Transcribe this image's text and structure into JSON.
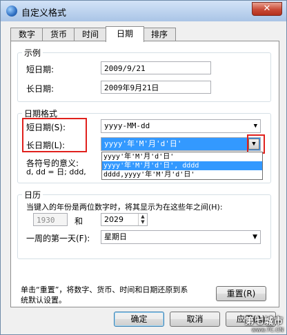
{
  "window": {
    "title": "自定义格式",
    "close_glyph": "✕"
  },
  "tabs": [
    {
      "label": "数字"
    },
    {
      "label": "货币"
    },
    {
      "label": "时间"
    },
    {
      "label": "日期"
    },
    {
      "label": "排序"
    }
  ],
  "example": {
    "group_title": "示例",
    "short_label": "短日期:",
    "short_value": "2009/9/21",
    "long_label": "长日期:",
    "long_value": "2009年9月21日"
  },
  "date_format": {
    "group_title": "日期格式",
    "short_label": "短日期(S):",
    "short_value": "yyyy-MM-dd",
    "long_label": "长日期(L):",
    "long_value": "yyyy'年'M'月'd'日'",
    "symbols_label": "各符号的意义:",
    "symbols_text": "d, dd = 日;  ddd,",
    "long_options": [
      "yyyy'年'M'月'd'日'",
      "yyyy'年'M'月'd'日', dddd",
      "dddd,yyyy'年'M'月'd'日'"
    ],
    "selected_option_index": 1
  },
  "calendar": {
    "group_title": "日历",
    "two_digit_text": "当键入的年份是两位数字时，将其显示为在这些年之间(H):",
    "year_from": "1930",
    "and_label": "和",
    "year_to": "2029",
    "first_day_label": "一周的第一天(F):",
    "first_day_value": "星期日"
  },
  "reset": {
    "text_line1": "单击“重置”，将数字、货币、时间和日期还原到系",
    "text_line2": "统默认设置。",
    "button_label": "重置(R)"
  },
  "footer": {
    "ok_label": "确定",
    "cancel_label": "取消",
    "apply_label": "应用(A)"
  },
  "watermark": {
    "title": "第七城市",
    "url": "www.7C.CN"
  },
  "colors": {
    "highlight_box": "#e0201c",
    "selection": "#3399ff"
  }
}
